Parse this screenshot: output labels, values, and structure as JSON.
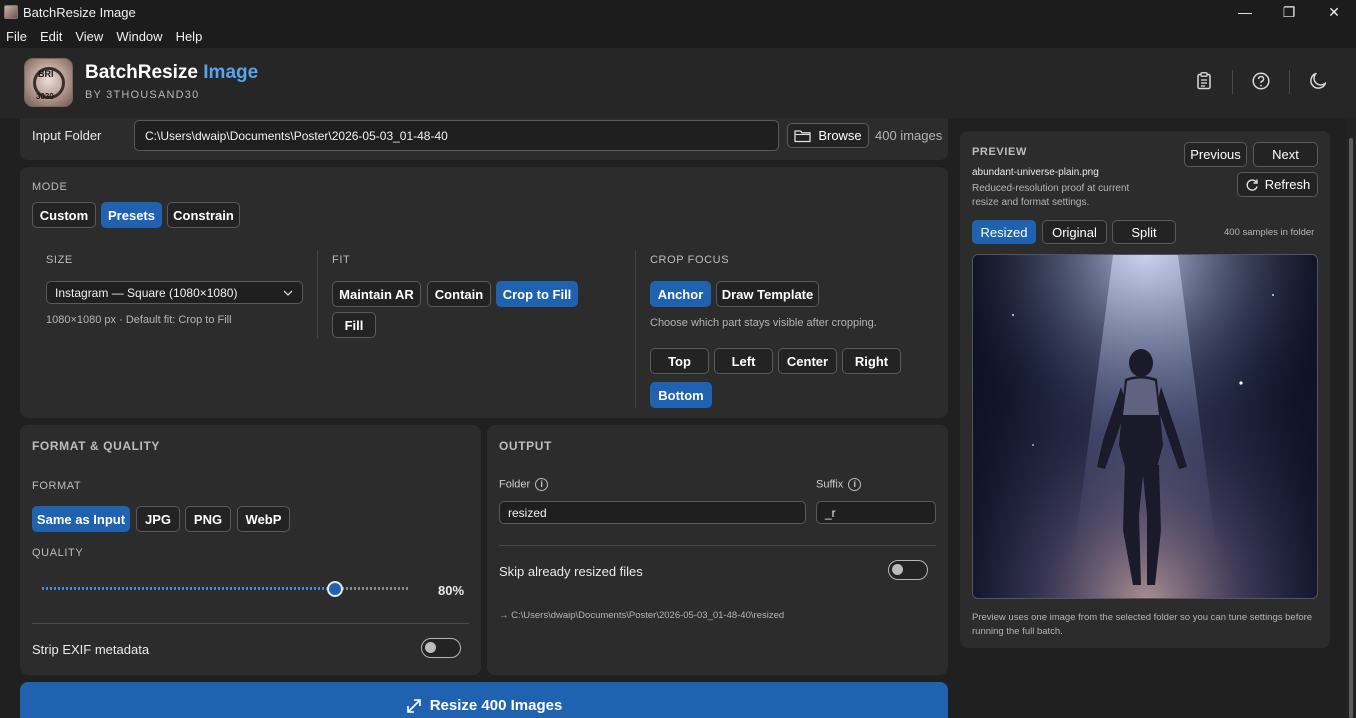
{
  "window": {
    "title": "BatchResize Image",
    "controls": {
      "minimize": "—",
      "maximize": "❐",
      "close": "✕"
    }
  },
  "menu": [
    "File",
    "Edit",
    "View",
    "Window",
    "Help"
  ],
  "header": {
    "logo_text_top": "BRI",
    "logo_text_bottom": "3030",
    "brand_main": "BatchResize",
    "brand_accent": "Image",
    "byline": "BY 3THOUSAND30",
    "icons": [
      "clipboard-icon",
      "help-icon",
      "moon-icon"
    ]
  },
  "input": {
    "label": "Input Folder",
    "path": "C:\\Users\\dwaip\\Documents\\Poster\\2026-05-03_01-48-40",
    "browse_label": "Browse",
    "count": "400 images"
  },
  "mode": {
    "label": "MODE",
    "options": [
      "Custom",
      "Presets",
      "Constrain"
    ],
    "selected": "Presets"
  },
  "size": {
    "label": "SIZE",
    "selected": "Instagram — Square (1080×1080)",
    "hint": "1080×1080 px  ·  Default fit: Crop to Fill"
  },
  "fit": {
    "label": "FIT",
    "options": [
      "Maintain AR",
      "Contain",
      "Crop to Fill",
      "Fill"
    ],
    "selected": "Crop to Fill"
  },
  "crop_focus": {
    "label": "CROP FOCUS",
    "modes": [
      "Anchor",
      "Draw Template"
    ],
    "selected_mode": "Anchor",
    "hint": "Choose which part stays visible after cropping.",
    "anchors": [
      "Top",
      "Left",
      "Center",
      "Right",
      "Bottom"
    ],
    "selected_anchor": "Bottom"
  },
  "format_quality": {
    "title": "FORMAT & QUALITY",
    "format_label": "FORMAT",
    "formats": [
      "Same as Input",
      "JPG",
      "PNG",
      "WebP"
    ],
    "selected_format": "Same as Input",
    "quality_label": "QUALITY",
    "quality_value": 0.8,
    "quality_text": "80%",
    "strip_exif_label": "Strip EXIF metadata",
    "strip_exif_on": false
  },
  "output": {
    "title": "OUTPUT",
    "folder_label": "Folder",
    "folder_value": "resized",
    "suffix_label": "Suffix",
    "suffix_value": "_r",
    "skip_label": "Skip already resized files",
    "skip_on": false,
    "dest_path": "→ C:\\Users\\dwaip\\Documents\\Poster\\2026-05-03_01-48-40\\resized"
  },
  "preview": {
    "label": "PREVIEW",
    "prev_label": "Previous",
    "next_label": "Next",
    "refresh_label": "Refresh",
    "filename": "abundant-universe-plain.png",
    "description": "Reduced-resolution proof at current resize and format settings.",
    "tabs": [
      "Resized",
      "Original",
      "Split"
    ],
    "selected_tab": "Resized",
    "samples": "400 samples in folder",
    "footer": "Preview uses one image from the selected folder so you can tune settings before running the full batch."
  },
  "action": {
    "resize_label": "Resize 400 Images"
  },
  "colors": {
    "accent": "#1f63b0",
    "brand_accent": "#5aa2ea",
    "background": "#202020",
    "panel": "#2c2c2c"
  }
}
